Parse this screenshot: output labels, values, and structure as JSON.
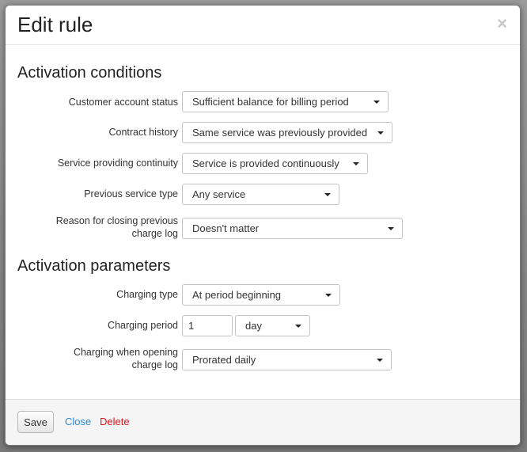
{
  "modal": {
    "title": "Edit rule",
    "close_glyph": "×"
  },
  "activation_conditions": {
    "heading": "Activation conditions",
    "fields": [
      {
        "label": "Customer account status",
        "value": "Sufficient balance for billing period"
      },
      {
        "label": "Contract history",
        "value": "Same service was previously provided"
      },
      {
        "label": "Service providing continuity",
        "value": "Service is provided continuously"
      },
      {
        "label": "Previous service type",
        "value": "Any service"
      },
      {
        "label": "Reason for closing previous charge log",
        "value": "Doesn't matter"
      }
    ]
  },
  "activation_parameters": {
    "heading": "Activation parameters",
    "charging_type": {
      "label": "Charging type",
      "value": "At period beginning"
    },
    "charging_period": {
      "label": "Charging period",
      "amount": "1",
      "unit": "day"
    },
    "charging_when_opening": {
      "label": "Charging when opening charge log",
      "value": "Prorated daily"
    }
  },
  "footer": {
    "save_label": "Save",
    "close_label": "Close",
    "delete_label": "Delete"
  },
  "icons": {
    "close": "close-icon",
    "dropdown": "caret-down-icon"
  },
  "colors": {
    "link": "#2a8ad8",
    "danger": "#d9141e",
    "footer_bg": "#f5f5f5"
  }
}
